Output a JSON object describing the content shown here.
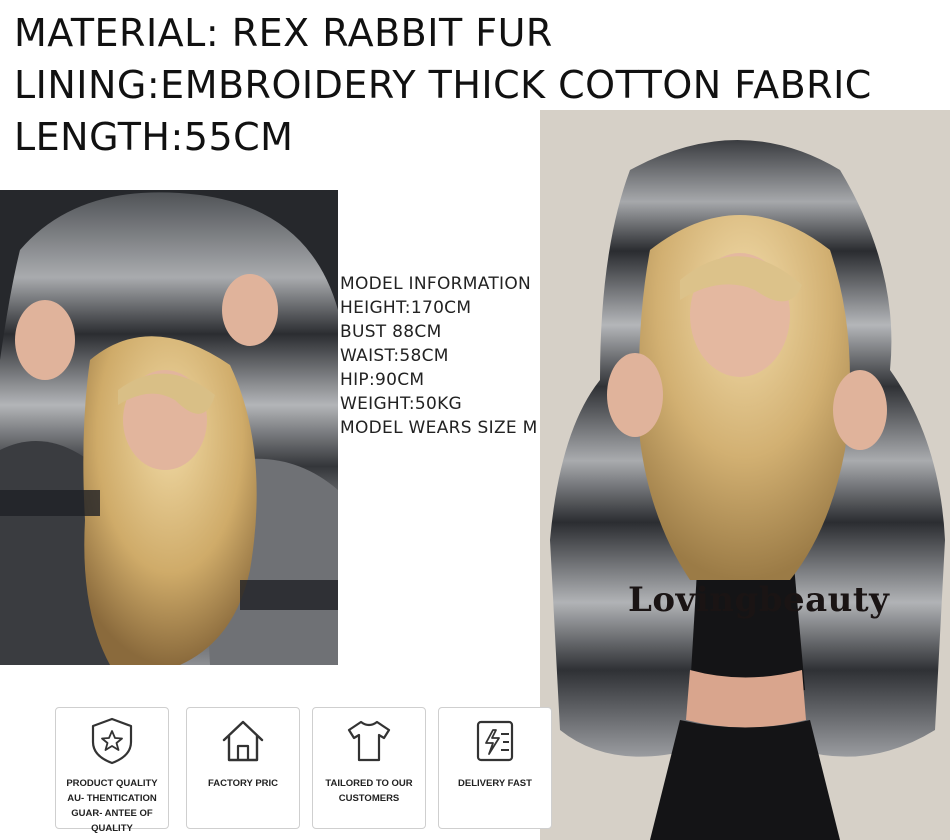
{
  "header": {
    "material": "MATERIAL: REX RABBIT FUR",
    "lining": "LINING:EMBROIDERY THICK COTTON FABRIC",
    "length": "LENGTH:55CM"
  },
  "model_info": {
    "title": "MODEL INFORMATION",
    "height": "HEIGHT:170CM",
    "bust": "BUST 88CM",
    "waist": "WAIST:58CM",
    "hip": "HIP:90CM",
    "weight": "WEIGHT:50KG",
    "size": "MODEL WEARS SIZE M"
  },
  "watermark": "Lovingbeauty",
  "badges": [
    {
      "label": "PRODUCT QUALITY AU- THENTICATION GUAR- ANTEE OF QUALITY",
      "icon": "shield-star-icon"
    },
    {
      "label": "FACTORY PRIC",
      "icon": "house-icon"
    },
    {
      "label": "TAILORED TO OUR CUSTOMERS",
      "icon": "tshirt-icon"
    },
    {
      "label": "DELIVERY FAST",
      "icon": "lightning-box-icon"
    }
  ],
  "colors": {
    "fur_dark": "#2b2d31",
    "fur_light": "#9a9ca0",
    "hair": "#d8b978",
    "badge_border": "#cfcfcf"
  }
}
